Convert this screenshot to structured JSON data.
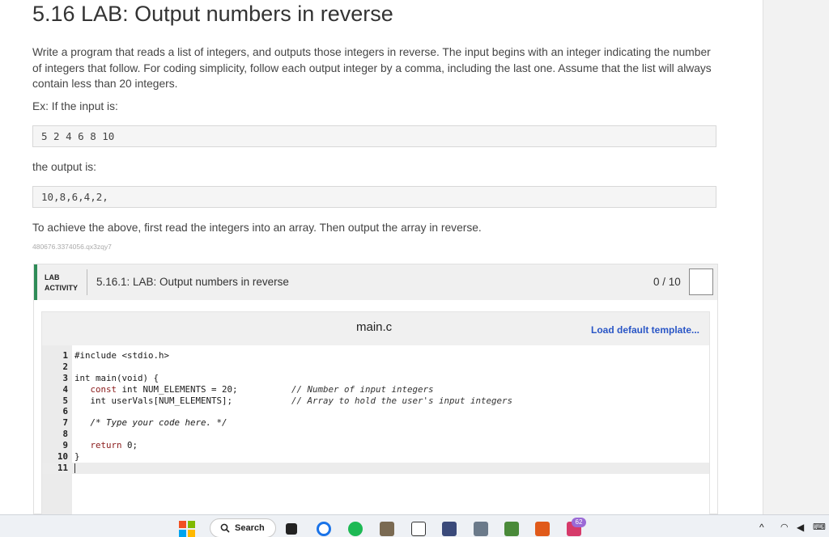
{
  "page": {
    "title": "5.16 LAB: Output numbers in reverse",
    "description": "Write a program that reads a list of integers, and outputs those integers in reverse. The input begins with an integer indicating the number of integers that follow. For coding simplicity, follow each output integer by a comma, including the last one. Assume that the list will always contain less than 20 integers.",
    "example_label": "Ex: If the input is:",
    "example_input": "5 2 4 6 8 10",
    "output_label": "the output is:",
    "example_output": "10,8,6,4,2,",
    "hint": "To achieve the above, first read the integers into an array. Then output the array in reverse.",
    "id_tag": "480676.3374056.qx3zqy7"
  },
  "lab": {
    "badge_line1": "LAB",
    "badge_line2": "ACTIVITY",
    "title": "5.16.1: LAB: Output numbers in reverse",
    "score": "0 / 10"
  },
  "editor": {
    "filename": "main.c",
    "load_template_label": "Load default template...",
    "lines": [
      {
        "n": "1",
        "code": "#include <stdio.h>",
        "comment": ""
      },
      {
        "n": "2",
        "code": "",
        "comment": ""
      },
      {
        "n": "3",
        "code": "int main(void) {",
        "comment": ""
      },
      {
        "n": "4",
        "code": "   const int NUM_ELEMENTS = 20;",
        "comment": "// Number of input integers"
      },
      {
        "n": "5",
        "code": "   int userVals[NUM_ELEMENTS];",
        "comment": "// Array to hold the user's input integers"
      },
      {
        "n": "6",
        "code": "",
        "comment": ""
      },
      {
        "n": "7",
        "code": "   /* Type your code here. */",
        "comment": ""
      },
      {
        "n": "8",
        "code": "",
        "comment": ""
      },
      {
        "n": "9",
        "code": "   return 0;",
        "comment": ""
      },
      {
        "n": "10",
        "code": "}",
        "comment": ""
      },
      {
        "n": "11",
        "code": "",
        "comment": ""
      }
    ]
  },
  "taskbar": {
    "search_label": "Search",
    "notification_count": "62",
    "tray_chevron": "^",
    "tray_wifi": "wifi-icon",
    "tray_volume": "volume-icon",
    "tray_lang": "language-icon"
  },
  "colors": {
    "accent_green": "#2e8b57",
    "link_blue": "#2a56c6"
  }
}
